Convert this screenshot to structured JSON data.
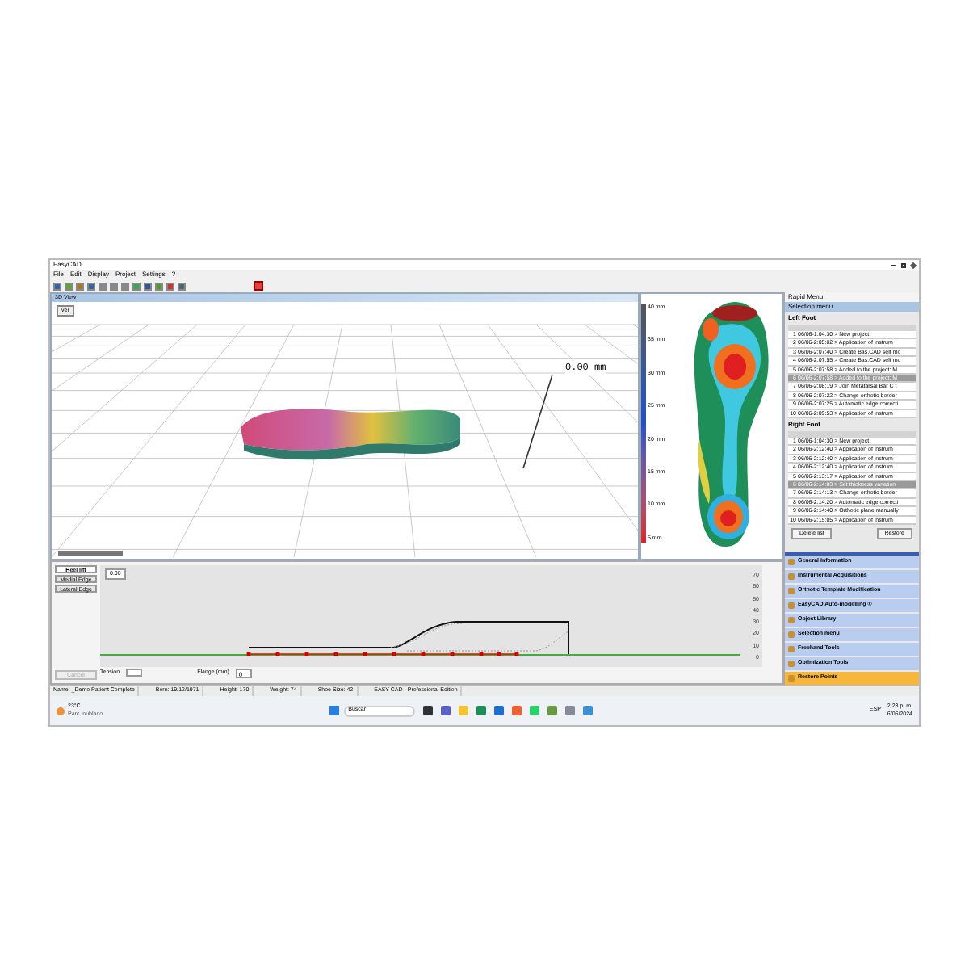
{
  "window": {
    "title": "EasyCAD"
  },
  "menu": [
    "File",
    "Edit",
    "Display",
    "Project",
    "Settings",
    "?"
  ],
  "view3d": {
    "title": "3D View",
    "button": "ver",
    "measure": "0.00 mm"
  },
  "scale": {
    "labels": [
      "40 mm",
      "35 mm",
      "30 mm",
      "25 mm",
      "20 mm",
      "15 mm",
      "10 mm",
      "5 mm"
    ]
  },
  "rapid_menu": {
    "title": "Rapid Menu",
    "section": "Selection menu",
    "left_foot": {
      "title": "Left Foot",
      "rows": [
        {
          "n": "1",
          "text": "06/06-1:04:30 > New project",
          "selected": false
        },
        {
          "n": "2",
          "text": "06/06-2:05:02 > Application of instrum",
          "selected": false
        },
        {
          "n": "3",
          "text": "06/06-2:07:40 > Create Bas.CAD self mo",
          "selected": false
        },
        {
          "n": "4",
          "text": "06/06-2:07:55 > Create Bas.CAD self mo",
          "selected": false
        },
        {
          "n": "5",
          "text": "06/06-2:07:58 > Added to the project: M",
          "selected": false
        },
        {
          "n": "6",
          "text": "06/06-2:07:58 > Added to the project: M",
          "selected": true
        },
        {
          "n": "7",
          "text": "06/06-2:08:19 > Join Metatarsal Bar C t",
          "selected": false
        },
        {
          "n": "8",
          "text": "06/06-2:07:22 > Change orthotic border",
          "selected": false
        },
        {
          "n": "9",
          "text": "06/06-2:07:25 > Automatic edge correcti",
          "selected": false
        },
        {
          "n": "10",
          "text": "06/06-2:09:53 > Application of instrum",
          "selected": false
        }
      ]
    },
    "right_foot": {
      "title": "Right Foot",
      "rows": [
        {
          "n": "1",
          "text": "06/06-1:04:30 > New project",
          "selected": false
        },
        {
          "n": "2",
          "text": "06/06-2:12:40 > Application of instrum",
          "selected": false
        },
        {
          "n": "3",
          "text": "06/06-2:12:40 > Application of instrum",
          "selected": false
        },
        {
          "n": "4",
          "text": "06/06-2:12:40 > Application of instrum",
          "selected": false
        },
        {
          "n": "5",
          "text": "06/06-2:13:17 > Application of instrum",
          "selected": false
        },
        {
          "n": "6",
          "text": "06/06-2:14:03 > Set thickness variation",
          "selected": true
        },
        {
          "n": "7",
          "text": "06/06-2:14:13 > Change orthotic border",
          "selected": false
        },
        {
          "n": "8",
          "text": "06/06-2:14:20 > Automatic edge correcti",
          "selected": false
        },
        {
          "n": "9",
          "text": "06/06-2:14:40 > Orthotic plane manually",
          "selected": false
        },
        {
          "n": "10",
          "text": "06/06-2:15:05 > Application of instrum",
          "selected": false
        }
      ]
    },
    "buttons": [
      "Delete list",
      "Restore"
    ]
  },
  "accordion": [
    {
      "label": "General Information",
      "selected": false
    },
    {
      "label": "Instrumental Acquisitions",
      "selected": false
    },
    {
      "label": "Orthotic Template Modification",
      "selected": false
    },
    {
      "label": "EasyCAD Auto-modelling ®",
      "selected": false
    },
    {
      "label": "Object Library",
      "selected": false
    },
    {
      "label": "Selection menu",
      "selected": false
    },
    {
      "label": "Freehand Tools",
      "selected": false
    },
    {
      "label": "Optimization Tools",
      "selected": false
    },
    {
      "label": "Restore Points",
      "selected": true
    }
  ],
  "profile": {
    "buttons": [
      {
        "label": "Heel lift",
        "selected": true
      },
      {
        "label": "Medial Edge",
        "selected": false
      },
      {
        "label": "Lateral Edge",
        "selected": false
      }
    ],
    "cancel": {
      "label": "Cancel",
      "disabled": true
    },
    "value": "0.00",
    "tension_label": "Tension",
    "flange_label": "Flange (mm)",
    "flange_value": "0",
    "scale_labels": [
      "70",
      "60",
      "50",
      "40",
      "30",
      "20",
      "10",
      "0"
    ]
  },
  "status_bar": [
    "Name: _Demo Patient Complete",
    "Born: 19/12/1971",
    "Height: 170",
    "Weight: 74",
    "Shoe Size: 42",
    "EASY CAD - Professional Edition"
  ],
  "taskbar": {
    "temp": "23°C",
    "weather": "Parc. nublado",
    "search": "Buscar",
    "lang": "ESP",
    "time": "2:23 p. m.",
    "date": "6/06/2024"
  }
}
